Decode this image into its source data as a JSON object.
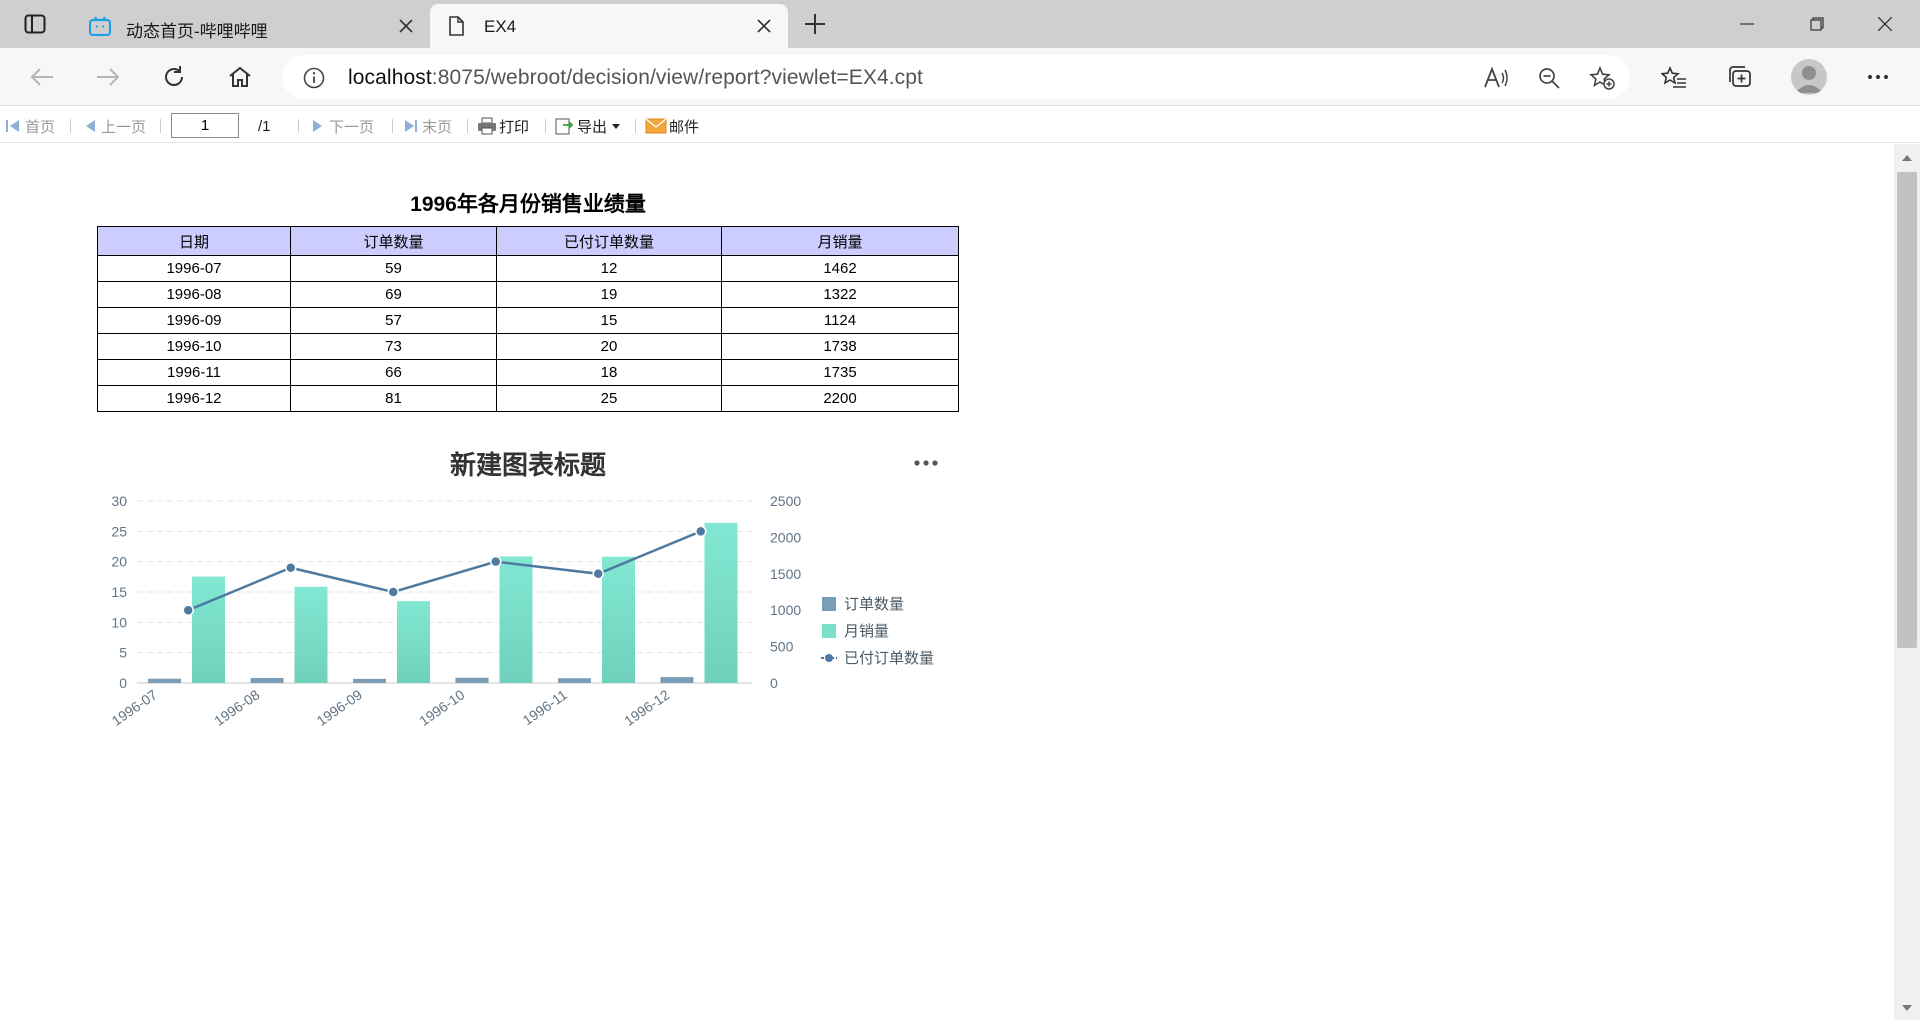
{
  "browser": {
    "tabs": [
      {
        "title": "动态首页-哔哩哔哩",
        "active": false,
        "favicon": "bilibili-icon"
      },
      {
        "title": "EX4",
        "active": true,
        "favicon": "page-icon"
      }
    ],
    "url_host": "localhost",
    "url_rest": ":8075/webroot/decision/view/report?viewlet=EX4.cpt"
  },
  "report_toolbar": {
    "first": "首页",
    "prev": "上一页",
    "page_value": "1",
    "page_total": "/1",
    "next": "下一页",
    "last": "末页",
    "print": "打印",
    "export": "导出",
    "email": "邮件"
  },
  "report": {
    "title": "1996年各月份销售业绩量",
    "headers": [
      "日期",
      "订单数量",
      "已付订单数量",
      "月销量"
    ],
    "rows": [
      [
        "1996-07",
        "59",
        "12",
        "1462"
      ],
      [
        "1996-08",
        "69",
        "19",
        "1322"
      ],
      [
        "1996-09",
        "57",
        "15",
        "1124"
      ],
      [
        "1996-10",
        "73",
        "20",
        "1738"
      ],
      [
        "1996-11",
        "66",
        "18",
        "1735"
      ],
      [
        "1996-12",
        "81",
        "25",
        "2200"
      ]
    ]
  },
  "chart_data": {
    "type": "bar",
    "title": "新建图表标题",
    "menu_icon": "more-dots-icon",
    "categories": [
      "1996-07",
      "1996-08",
      "1996-09",
      "1996-10",
      "1996-11",
      "1996-12"
    ],
    "left_axis": {
      "ticks": [
        "0",
        "5",
        "10",
        "15",
        "20",
        "25",
        "30"
      ],
      "ylim": [
        0,
        30
      ]
    },
    "right_axis": {
      "ticks": [
        "0",
        "500",
        "1000",
        "1500",
        "2000",
        "2500"
      ],
      "ylim": [
        0,
        2500
      ]
    },
    "series": [
      {
        "name": "订单数量",
        "type": "bar",
        "axis": "right",
        "color": "#7b9db5",
        "values": [
          59,
          69,
          57,
          73,
          66,
          81
        ]
      },
      {
        "name": "月销量",
        "type": "bar",
        "axis": "right",
        "color": "#7be0c9",
        "values": [
          1462,
          1322,
          1124,
          1738,
          1735,
          2200
        ]
      },
      {
        "name": "已付订单数量",
        "type": "line",
        "axis": "left",
        "color": "#4f7aa0",
        "values": [
          12,
          19,
          15,
          20,
          18,
          25
        ]
      }
    ],
    "grid": true,
    "legend_position": "right"
  }
}
